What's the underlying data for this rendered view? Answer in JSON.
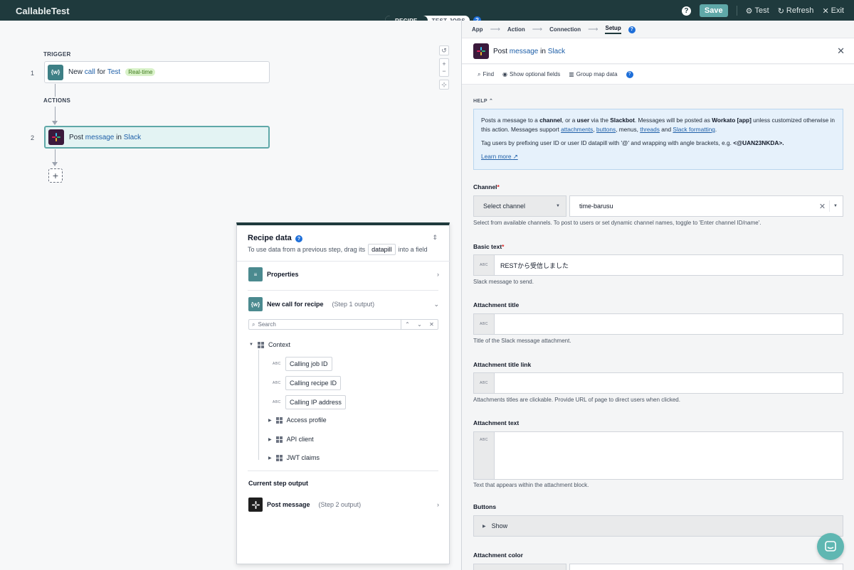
{
  "app": {
    "title": "CallableTest"
  },
  "topbar": {
    "help_icon": "question-circle-icon",
    "save_label": "Save",
    "test_label": "Test",
    "refresh_label": "Refresh",
    "exit_label": "Exit"
  },
  "mode": {
    "recipe": "RECIPE",
    "test_jobs": "TEST JOBS"
  },
  "canvas": {
    "trigger_label": "TRIGGER",
    "actions_label": "ACTIONS",
    "steps": [
      {
        "num": "1",
        "icon": "{w}",
        "pre": "New ",
        "kw": "call",
        "mid": " for ",
        "app": "Test",
        "badge": "Real-time"
      },
      {
        "num": "2",
        "icon": "slack",
        "pre": "Post ",
        "kw": "message",
        "mid": " in ",
        "app": "Slack"
      }
    ],
    "add_label": "+"
  },
  "recipe_data": {
    "title": "Recipe data",
    "sub_pre": "To use data from a previous step, drag its",
    "pill": "datapill",
    "sub_post": "into a field",
    "properties": "Properties",
    "step1_title": "New call for recipe",
    "step1_meta": "(Step 1 output)",
    "search_placeholder": "Search",
    "context_label": "Context",
    "fields": [
      "Calling job ID",
      "Calling recipe ID",
      "Calling IP address"
    ],
    "objects": [
      "Access profile",
      "API client",
      "JWT claims"
    ],
    "current_label": "Current step output",
    "step2_title": "Post message",
    "step2_meta": "(Step 2 output)"
  },
  "setup": {
    "nav": [
      "App",
      "Action",
      "Connection",
      "Setup"
    ],
    "header_pre": "Post ",
    "header_kw": "message",
    "header_mid": " in ",
    "header_app": "Slack",
    "tools": {
      "find": "Find",
      "optional": "Show optional fields",
      "group": "Group map data"
    },
    "help_label": "HELP",
    "help": {
      "p1a": "Posts a message to a ",
      "p1b": "channel",
      "p1c": ", or a ",
      "p1d": "user",
      "p1e": " via the ",
      "p1f": "Slackbot",
      "p1g": ". Messages will be posted as ",
      "p1h": "Workato [app]",
      "p1i": " unless customized otherwise in this action. Messages support ",
      "l_attach": "attachments",
      "l_buttons": "buttons",
      "p1j": ", menus, ",
      "l_threads": "threads",
      "p1k": " and ",
      "l_format": "Slack formatting",
      "p2a": "Tag users by prefixing user ID or user ID datapill with '@' and wrapping with angle brackets, e.g. ",
      "p2b": "<@UAN23NKDA>.",
      "learn": "Learn more"
    },
    "channel": {
      "label": "Channel",
      "select_label": "Select channel",
      "value": "time-barusu",
      "hint": "Select from available channels. To post to users or set dynamic channel names, toggle to 'Enter channel ID/name'."
    },
    "basic_text": {
      "label": "Basic text",
      "value": "RESTから受信しました",
      "hint": "Slack message to send."
    },
    "att_title": {
      "label": "Attachment title",
      "hint": "Title of the Slack message attachment."
    },
    "att_link": {
      "label": "Attachment title link",
      "hint": "Attachments titles are clickable. Provide URL of page to direct users when clicked."
    },
    "att_text": {
      "label": "Attachment text",
      "hint": "Text that appears within the attachment block."
    },
    "buttons": {
      "label": "Buttons",
      "show": "Show"
    },
    "att_color": {
      "label": "Attachment color"
    },
    "abc": "ABC"
  }
}
